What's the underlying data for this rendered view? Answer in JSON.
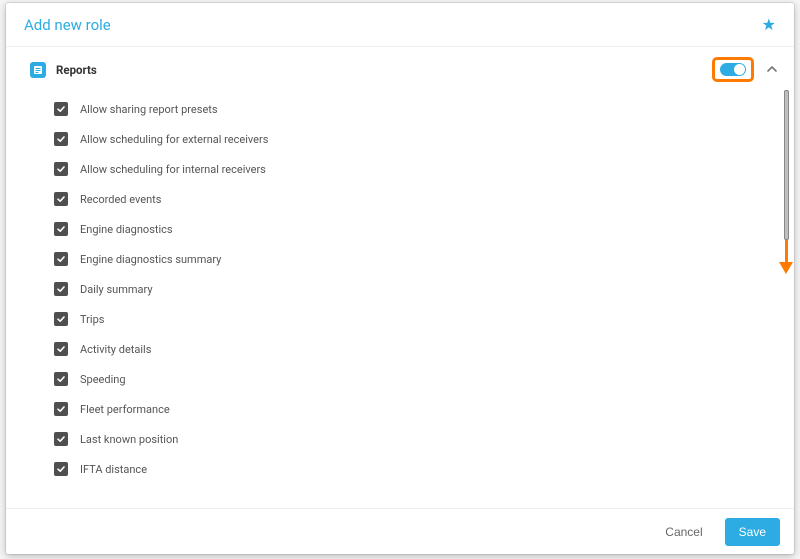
{
  "header": {
    "title": "Add new role"
  },
  "section": {
    "title": "Reports",
    "toggle_on": true,
    "expanded": true
  },
  "permissions": [
    {
      "label": "Allow sharing report presets",
      "checked": true
    },
    {
      "label": "Allow scheduling for external receivers",
      "checked": true
    },
    {
      "label": "Allow scheduling for internal receivers",
      "checked": true
    },
    {
      "label": "Recorded events",
      "checked": true
    },
    {
      "label": "Engine diagnostics",
      "checked": true
    },
    {
      "label": "Engine diagnostics summary",
      "checked": true
    },
    {
      "label": "Daily summary",
      "checked": true
    },
    {
      "label": "Trips",
      "checked": true
    },
    {
      "label": "Activity details",
      "checked": true
    },
    {
      "label": "Speeding",
      "checked": true
    },
    {
      "label": "Fleet performance",
      "checked": true
    },
    {
      "label": "Last known position",
      "checked": true
    },
    {
      "label": "IFTA distance",
      "checked": true
    }
  ],
  "footer": {
    "cancel": "Cancel",
    "save": "Save"
  },
  "colors": {
    "accent": "#2cace3",
    "highlight": "#ff7a00"
  }
}
